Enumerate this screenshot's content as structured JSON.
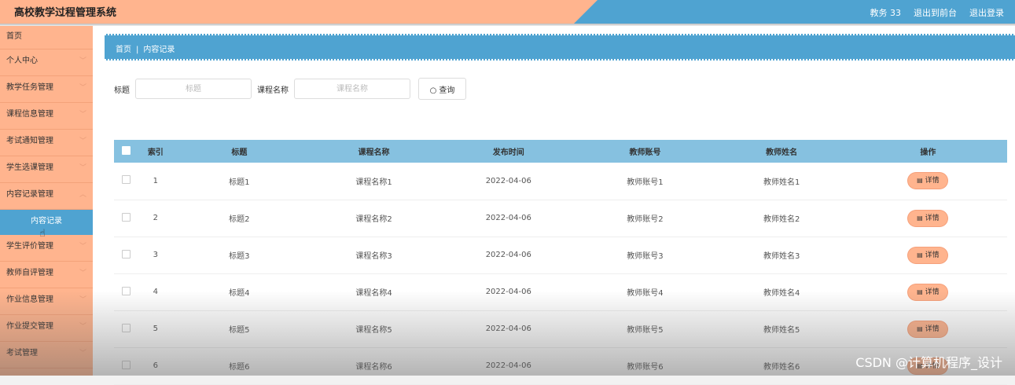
{
  "header": {
    "title": "高校教学过程管理系统",
    "user": "教务 33",
    "front_link": "退出到前台",
    "logout_link": "退出登录"
  },
  "sidebar": {
    "items": [
      {
        "label": "首页"
      },
      {
        "label": "个人中心"
      },
      {
        "label": "教学任务管理"
      },
      {
        "label": "课程信息管理"
      },
      {
        "label": "考试通知管理"
      },
      {
        "label": "学生选课管理"
      },
      {
        "label": "内容记录管理"
      },
      {
        "label": "学生评价管理"
      },
      {
        "label": "教师自评管理"
      },
      {
        "label": "作业信息管理"
      },
      {
        "label": "作业提交管理"
      },
      {
        "label": "考试管理"
      }
    ],
    "active_sub": "内容记录"
  },
  "breadcrumb": {
    "home": "首页",
    "current": "内容记录"
  },
  "search": {
    "title_label": "标题",
    "title_placeholder": "标题",
    "course_label": "课程名称",
    "course_placeholder": "课程名称",
    "button": "查询"
  },
  "table": {
    "headers": [
      "索引",
      "标题",
      "课程名称",
      "发布时间",
      "教师账号",
      "教师姓名",
      "操作"
    ],
    "detail_label": "详情",
    "rows": [
      {
        "index": "1",
        "title": "标题1",
        "course": "课程名称1",
        "date": "2022-04-06",
        "account": "教师账号1",
        "name": "教师姓名1"
      },
      {
        "index": "2",
        "title": "标题2",
        "course": "课程名称2",
        "date": "2022-04-06",
        "account": "教师账号2",
        "name": "教师姓名2"
      },
      {
        "index": "3",
        "title": "标题3",
        "course": "课程名称3",
        "date": "2022-04-06",
        "account": "教师账号3",
        "name": "教师姓名3"
      },
      {
        "index": "4",
        "title": "标题4",
        "course": "课程名称4",
        "date": "2022-04-06",
        "account": "教师账号4",
        "name": "教师姓名4"
      },
      {
        "index": "5",
        "title": "标题5",
        "course": "课程名称5",
        "date": "2022-04-06",
        "account": "教师账号5",
        "name": "教师姓名5"
      },
      {
        "index": "6",
        "title": "标题6",
        "course": "课程名称6",
        "date": "2022-04-06",
        "account": "教师账号6",
        "name": "教师姓名6"
      }
    ]
  },
  "watermark": "CSDN @计算机程序_设计",
  "colors": {
    "accent_orange": "#ffb48e",
    "accent_blue": "#4fa3d1",
    "table_header": "#86c1e0"
  }
}
